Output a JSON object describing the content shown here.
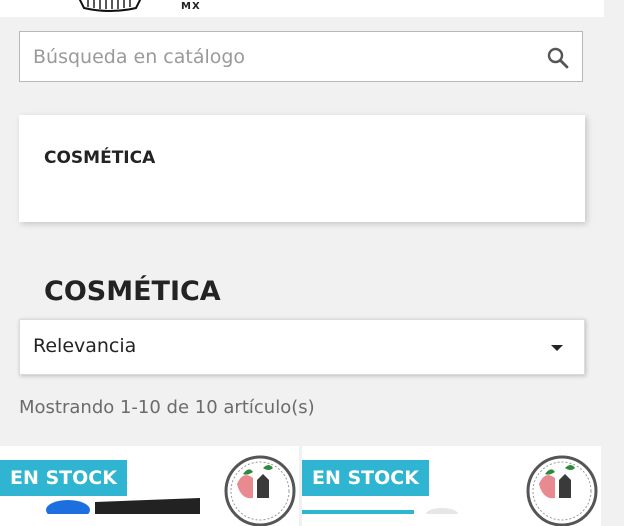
{
  "header": {
    "logo_text": "MX"
  },
  "search": {
    "placeholder": "Búsqueda en catálogo",
    "value": ""
  },
  "category_block": {
    "title": "COSMÉTICA"
  },
  "page": {
    "title": "COSMÉTICA"
  },
  "sort": {
    "selected": "Relevancia"
  },
  "results": {
    "count_text": "Mostrando 1-10 de 10 artículo(s)"
  },
  "products": [
    {
      "badge": "EN STOCK"
    },
    {
      "badge": "EN STOCK"
    }
  ],
  "colors": {
    "badge_bg": "#2fb5d2",
    "page_bg": "#f1f1f1"
  }
}
